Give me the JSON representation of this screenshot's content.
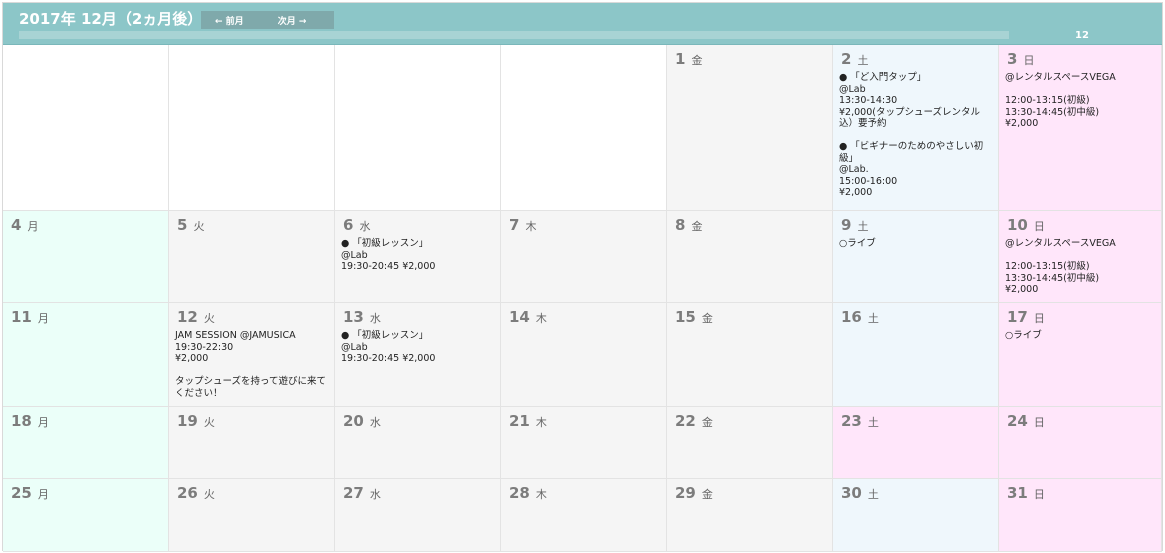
{
  "header": {
    "title": "2017年 12月（2ヵ月後）",
    "prev_label": "← 前月",
    "next_label": "次月 →",
    "progress_label": "12"
  },
  "weeks": [
    [
      {
        "day": "",
        "wd": "",
        "events": "",
        "kind": "empty"
      },
      {
        "day": "",
        "wd": "",
        "events": "",
        "kind": "empty"
      },
      {
        "day": "",
        "wd": "",
        "events": "",
        "kind": "empty"
      },
      {
        "day": "",
        "wd": "",
        "events": "",
        "kind": "empty"
      },
      {
        "day": "1",
        "wd": "金",
        "events": "",
        "kind": "normal"
      },
      {
        "day": "2",
        "wd": "土",
        "events": "● 「ど入門タップ」\n@Lab\n13:30-14:30\n¥2,000(タップシューズレンタル込）要予約\n\n● 「ビギナーのためのやさしい初級」\n@Lab.\n15:00-16:00\n¥2,000",
        "kind": "sat"
      },
      {
        "day": "3",
        "wd": "日",
        "events": "@レンタルスペースVEGA\n\n12:00-13:15(初級)\n13:30-14:45(初中級)\n¥2,000",
        "kind": "sun"
      }
    ],
    [
      {
        "day": "4",
        "wd": "月",
        "events": "",
        "kind": "mon"
      },
      {
        "day": "5",
        "wd": "火",
        "events": "",
        "kind": "normal"
      },
      {
        "day": "6",
        "wd": "水",
        "events": "● 「初級レッスン」\n@Lab\n19:30-20:45 ¥2,000",
        "kind": "normal"
      },
      {
        "day": "7",
        "wd": "木",
        "events": "",
        "kind": "normal"
      },
      {
        "day": "8",
        "wd": "金",
        "events": "",
        "kind": "normal"
      },
      {
        "day": "9",
        "wd": "土",
        "events": "○ライブ",
        "kind": "sat"
      },
      {
        "day": "10",
        "wd": "日",
        "events": "@レンタルスペースVEGA\n\n12:00-13:15(初級)\n13:30-14:45(初中級)\n¥2,000",
        "kind": "sun"
      }
    ],
    [
      {
        "day": "11",
        "wd": "月",
        "events": "",
        "kind": "mon"
      },
      {
        "day": "12",
        "wd": "火",
        "events": "JAM SESSION @JAMUSICA\n19:30-22:30\n¥2,000\n\nタップシューズを持って遊びに来てください！",
        "kind": "normal"
      },
      {
        "day": "13",
        "wd": "水",
        "events": "● 「初級レッスン」\n@Lab\n19:30-20:45 ¥2,000",
        "kind": "normal"
      },
      {
        "day": "14",
        "wd": "木",
        "events": "",
        "kind": "normal"
      },
      {
        "day": "15",
        "wd": "金",
        "events": "",
        "kind": "normal"
      },
      {
        "day": "16",
        "wd": "土",
        "events": "",
        "kind": "sat"
      },
      {
        "day": "17",
        "wd": "日",
        "events": "○ライブ",
        "kind": "sun"
      }
    ],
    [
      {
        "day": "18",
        "wd": "月",
        "events": "",
        "kind": "mon"
      },
      {
        "day": "19",
        "wd": "火",
        "events": "",
        "kind": "normal"
      },
      {
        "day": "20",
        "wd": "水",
        "events": "",
        "kind": "normal"
      },
      {
        "day": "21",
        "wd": "木",
        "events": "",
        "kind": "normal"
      },
      {
        "day": "22",
        "wd": "金",
        "events": "",
        "kind": "normal"
      },
      {
        "day": "23",
        "wd": "土",
        "events": "",
        "kind": "hol"
      },
      {
        "day": "24",
        "wd": "日",
        "events": "",
        "kind": "sun"
      }
    ],
    [
      {
        "day": "25",
        "wd": "月",
        "events": "",
        "kind": "mon"
      },
      {
        "day": "26",
        "wd": "火",
        "events": "",
        "kind": "normal"
      },
      {
        "day": "27",
        "wd": "水",
        "events": "",
        "kind": "normal"
      },
      {
        "day": "28",
        "wd": "木",
        "events": "",
        "kind": "normal"
      },
      {
        "day": "29",
        "wd": "金",
        "events": "",
        "kind": "normal"
      },
      {
        "day": "30",
        "wd": "土",
        "events": "",
        "kind": "sat"
      },
      {
        "day": "31",
        "wd": "日",
        "events": "",
        "kind": "sun"
      }
    ]
  ]
}
